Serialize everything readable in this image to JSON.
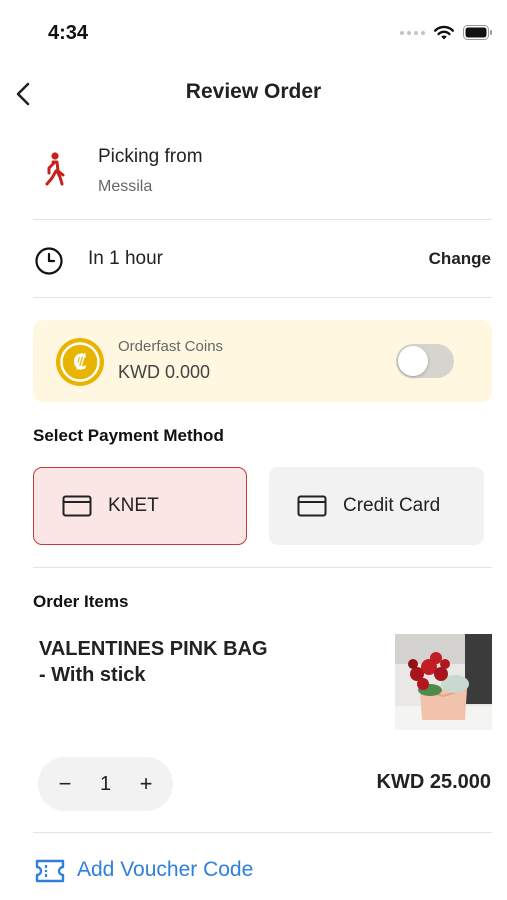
{
  "status_bar": {
    "time": "4:34"
  },
  "header": {
    "title": "Review Order"
  },
  "pickup": {
    "title": "Picking from",
    "location": "Messila"
  },
  "timing": {
    "label": "In 1 hour",
    "change_label": "Change"
  },
  "coins": {
    "title": "Orderfast Coins",
    "value": "KWD 0.000",
    "enabled": false
  },
  "payment": {
    "label": "Select Payment Method",
    "methods": [
      {
        "label": "KNET",
        "selected": true
      },
      {
        "label": "Credit Card",
        "selected": false
      }
    ]
  },
  "order": {
    "label": "Order Items",
    "items": [
      {
        "name": "VALENTINES PINK BAG - With stick",
        "quantity": "1",
        "minus": "−",
        "plus": "+",
        "price": "KWD 25.000"
      }
    ]
  },
  "voucher": {
    "label": "Add Voucher Code"
  },
  "colors": {
    "accent_red": "#c53a3a",
    "coin_gold": "#e8b400",
    "link_blue": "#2f7fdc",
    "coins_bg": "#fff7df"
  }
}
